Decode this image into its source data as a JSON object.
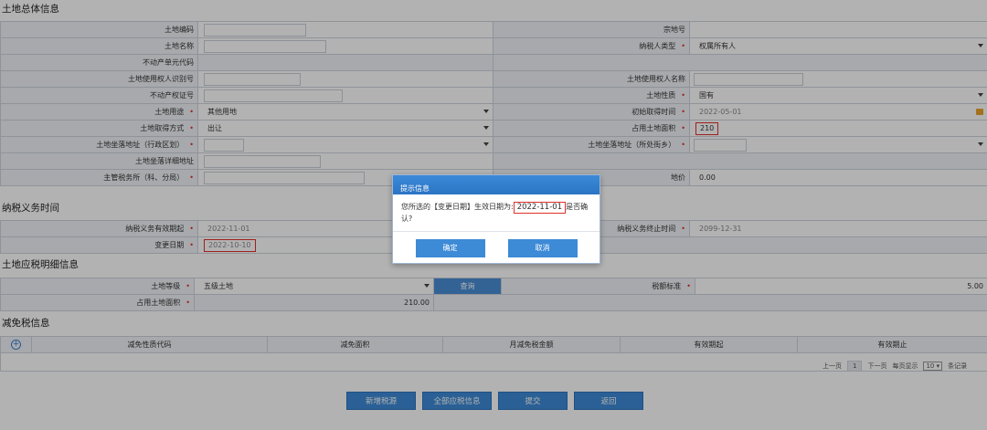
{
  "sections": {
    "overall": "土地总体信息",
    "tax_period": "纳税义务时间",
    "tax_detail": "土地应税明细信息",
    "relief": "减免税信息"
  },
  "overall": {
    "land_code_label": "土地编码",
    "parcel_no_label": "宗地号",
    "land_name_label": "土地名称",
    "taxpayer_type_label": "纳税人类型",
    "taxpayer_type_value": "权属所有人",
    "property_unit_code_label": "不动产单元代码",
    "user_id_label": "土地使用权人识别号",
    "user_name_label": "土地使用权人名称",
    "property_cert_label": "不动产权证号",
    "land_nature_label": "土地性质",
    "land_nature_value": "国有",
    "land_use_label": "土地用途",
    "land_use_value": "其他用地",
    "initial_date_label": "初始取得时间",
    "initial_date_value": "2022-05-01",
    "acquire_method_label": "土地取得方式",
    "acquire_method_value": "出让",
    "area_label": "占用土地面积",
    "area_value": "210",
    "address_admin_label": "土地坐落地址（行政区划）",
    "address_street_label": "土地坐落地址（所处街乡）",
    "detail_address_label": "土地坐落详细地址",
    "tax_office_label": "主管税务所（科、分局）",
    "price_label": "地价",
    "price_value": "0.00"
  },
  "tax_period": {
    "start_label": "纳税义务有效期起",
    "start_value": "2022-11-01",
    "end_label": "纳税义务终止时间",
    "end_value": "2099-12-31",
    "change_date_label": "变更日期",
    "change_date_value": "2022-10-10"
  },
  "tax_detail": {
    "grade_label": "土地等级",
    "grade_value": "五级土地",
    "query_label": "查询",
    "standard_label": "税额标准",
    "standard_value": "5.00",
    "area_label": "占用土地面积",
    "area_value": "210.00"
  },
  "relief": {
    "columns": [
      "减免性质代码",
      "减免面积",
      "月减免税金额",
      "有效期起",
      "有效期止"
    ]
  },
  "pager": {
    "prev": "上一页",
    "current": "1",
    "next": "下一页",
    "per_page_prefix": "每页显示",
    "per_page_value": "10",
    "per_page_suffix": "条记录"
  },
  "actions": {
    "add_relief": "新增税源",
    "all_tax_info": "全部应税信息",
    "submit": "提交",
    "back": "返回"
  },
  "dialog": {
    "title": "提示信息",
    "message_prefix": "您所选的【变更日期】生效日期为:",
    "message_date": "2022-11-01",
    "message_suffix": "是否确",
    "message_line2": "认?",
    "confirm": "确定",
    "cancel": "取消"
  },
  "colors": {
    "primary": "#3d8ad6",
    "required": "#e0302b",
    "label_bg": "#f0f3f7"
  }
}
